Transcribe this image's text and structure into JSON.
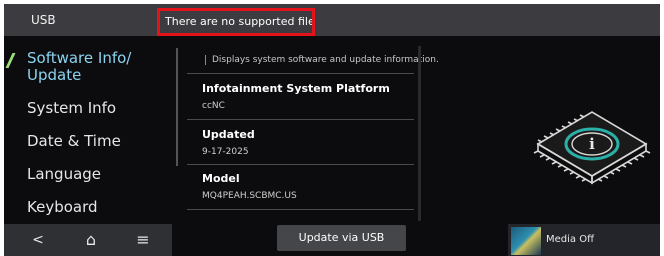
{
  "topbar": {
    "source_label": "USB",
    "notice": "There are no supported files."
  },
  "sidebar": {
    "items": [
      {
        "label": "Software Info/\nUpdate",
        "active": true
      },
      {
        "label": "System Info"
      },
      {
        "label": "Date & Time"
      },
      {
        "label": "Language"
      },
      {
        "label": "Keyboard"
      }
    ]
  },
  "main": {
    "description": "Displays system software and update information.",
    "rows": [
      {
        "title": "Infotainment System Platform",
        "value": "ccNC"
      },
      {
        "title": "Updated",
        "value": "9-17-2025"
      },
      {
        "title": "Model",
        "value": "MQ4PEAH.SCBMC.US"
      }
    ],
    "update_button": "Update via USB"
  },
  "bottombar": {
    "nav": [
      {
        "icon": "back-icon",
        "glyph": "<"
      },
      {
        "icon": "home-icon",
        "glyph": "⌂"
      },
      {
        "icon": "menu-icon",
        "glyph": "≡"
      }
    ],
    "media_label": "Media Off"
  },
  "colors": {
    "accent_text": "#8bd3ef",
    "active_marker": "#9be07a",
    "highlight_box": "#e4121b"
  }
}
